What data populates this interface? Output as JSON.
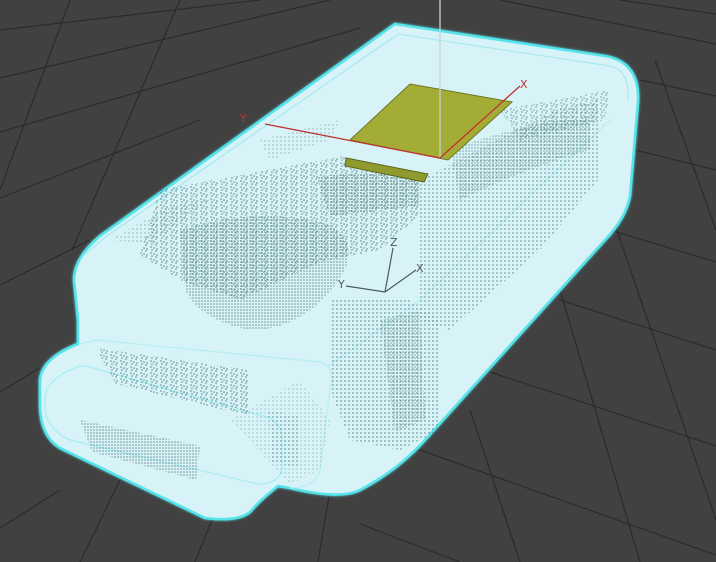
{
  "viewport": {
    "view": "perspective",
    "background_color": "#414141",
    "grid_color": "#2a2a2a",
    "object": {
      "type": "selected-mesh",
      "body_fill_color": "#d8f3f7",
      "selection_outline_color": "#55e3ec",
      "stipple_color": "#3c6a6c"
    },
    "light_gizmo": {
      "color": "#a3ad36"
    },
    "world_axis_gizmo": {
      "x_label": "X",
      "y_label": "Y",
      "x_color": "#c0322e",
      "y_color": "#c0322e",
      "z_color": "#c8d2d6"
    },
    "pivot_gizmo": {
      "x_label": "X",
      "y_label": "Y",
      "z_label": "Z",
      "color": "#4d5a5c"
    }
  }
}
